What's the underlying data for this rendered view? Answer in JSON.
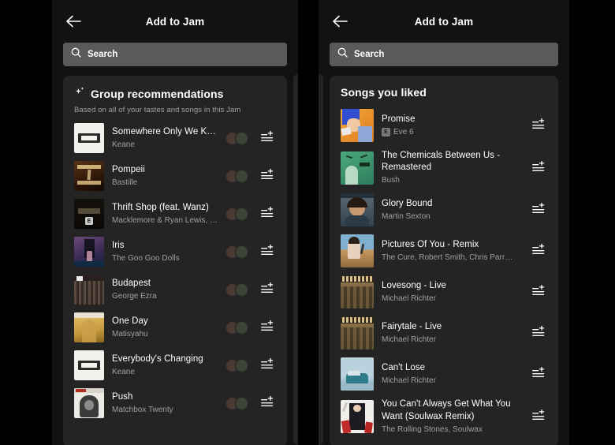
{
  "theme": {
    "bg": "#000000",
    "panel_bg": "#121212",
    "card_bg": "#242424",
    "search_bg": "#5a5a5a",
    "text_primary": "#ffffff",
    "text_secondary": "#a0a0a0"
  },
  "left_panel": {
    "header": {
      "back_icon": "back-arrow-icon",
      "title": "Add to Jam"
    },
    "search": {
      "icon": "search-icon",
      "placeholder": "Search",
      "value": ""
    },
    "card": {
      "sparkle_icon": "sparkle-icon",
      "title": "Group recommendations",
      "subtitle": "Based on all of your tastes and songs in this Jam",
      "songs": [
        {
          "title": "Somewhere Only We Kn…",
          "artist": "Keane",
          "explicit": false,
          "art": "keane-white",
          "avatars": 2,
          "action_icon": "add-to-queue-icon"
        },
        {
          "title": "Pompeii",
          "artist": "Bastille",
          "explicit": false,
          "art": "bastille-brown",
          "avatars": 2,
          "action_icon": "add-to-queue-icon"
        },
        {
          "title": "Thrift Shop (feat. Wanz)",
          "artist": "Macklemore & Ryan Lewis, M…",
          "explicit": true,
          "art": "heist-dark",
          "avatars": 2,
          "action_icon": "add-to-queue-icon"
        },
        {
          "title": "Iris",
          "artist": "The Goo Goo Dolls",
          "explicit": false,
          "art": "iris-purple",
          "avatars": 2,
          "action_icon": "add-to-queue-icon"
        },
        {
          "title": "Budapest",
          "artist": "George Ezra",
          "explicit": false,
          "art": "budapest-crowd",
          "avatars": 2,
          "action_icon": "add-to-queue-icon"
        },
        {
          "title": "One Day",
          "artist": "Matisyahu",
          "explicit": false,
          "art": "matisyahu-gold",
          "avatars": 2,
          "action_icon": "add-to-queue-icon"
        },
        {
          "title": "Everybody's Changing",
          "artist": "Keane",
          "explicit": false,
          "art": "keane-white",
          "avatars": 2,
          "action_icon": "add-to-queue-icon"
        },
        {
          "title": "Push",
          "artist": "Matchbox Twenty",
          "explicit": false,
          "art": "matchbox-gorilla",
          "avatars": 2,
          "action_icon": "add-to-queue-icon"
        }
      ]
    }
  },
  "right_panel": {
    "header": {
      "back_icon": "back-arrow-icon",
      "title": "Add to Jam"
    },
    "search": {
      "icon": "search-icon",
      "placeholder": "Search",
      "value": ""
    },
    "card": {
      "title": "Songs you liked",
      "songs": [
        {
          "title": "Promise",
          "artist": "Eve 6",
          "explicit": true,
          "art": "promise-anime",
          "action_icon": "add-to-queue-icon"
        },
        {
          "title": "The Chemicals Between Us - Remastered",
          "artist": "Bush",
          "explicit": false,
          "art": "bush-green",
          "action_icon": "add-to-queue-icon"
        },
        {
          "title": "Glory Bound",
          "artist": "Martin Sexton",
          "explicit": false,
          "art": "sexton-photo",
          "action_icon": "add-to-queue-icon"
        },
        {
          "title": "Pictures Of You - Remix",
          "artist": "The Cure, Robert Smith, Chris Parr…",
          "explicit": false,
          "art": "cure-baby",
          "action_icon": "add-to-queue-icon"
        },
        {
          "title": "Lovesong - Live",
          "artist": "Michael Richter",
          "explicit": false,
          "art": "richter-sepia",
          "action_icon": "add-to-queue-icon"
        },
        {
          "title": "Fairytale - Live",
          "artist": "Michael Richter",
          "explicit": false,
          "art": "richter-sepia",
          "action_icon": "add-to-queue-icon"
        },
        {
          "title": "Can't Lose",
          "artist": "Michael Richter",
          "explicit": false,
          "art": "cantlose-blue",
          "action_icon": "add-to-queue-icon"
        },
        {
          "title": "You Can't Always Get What You Want (Soulwax Remix)",
          "artist": "The Rolling Stones, Soulwax",
          "explicit": false,
          "art": "stones-white",
          "action_icon": "add-to-queue-icon"
        }
      ]
    }
  }
}
